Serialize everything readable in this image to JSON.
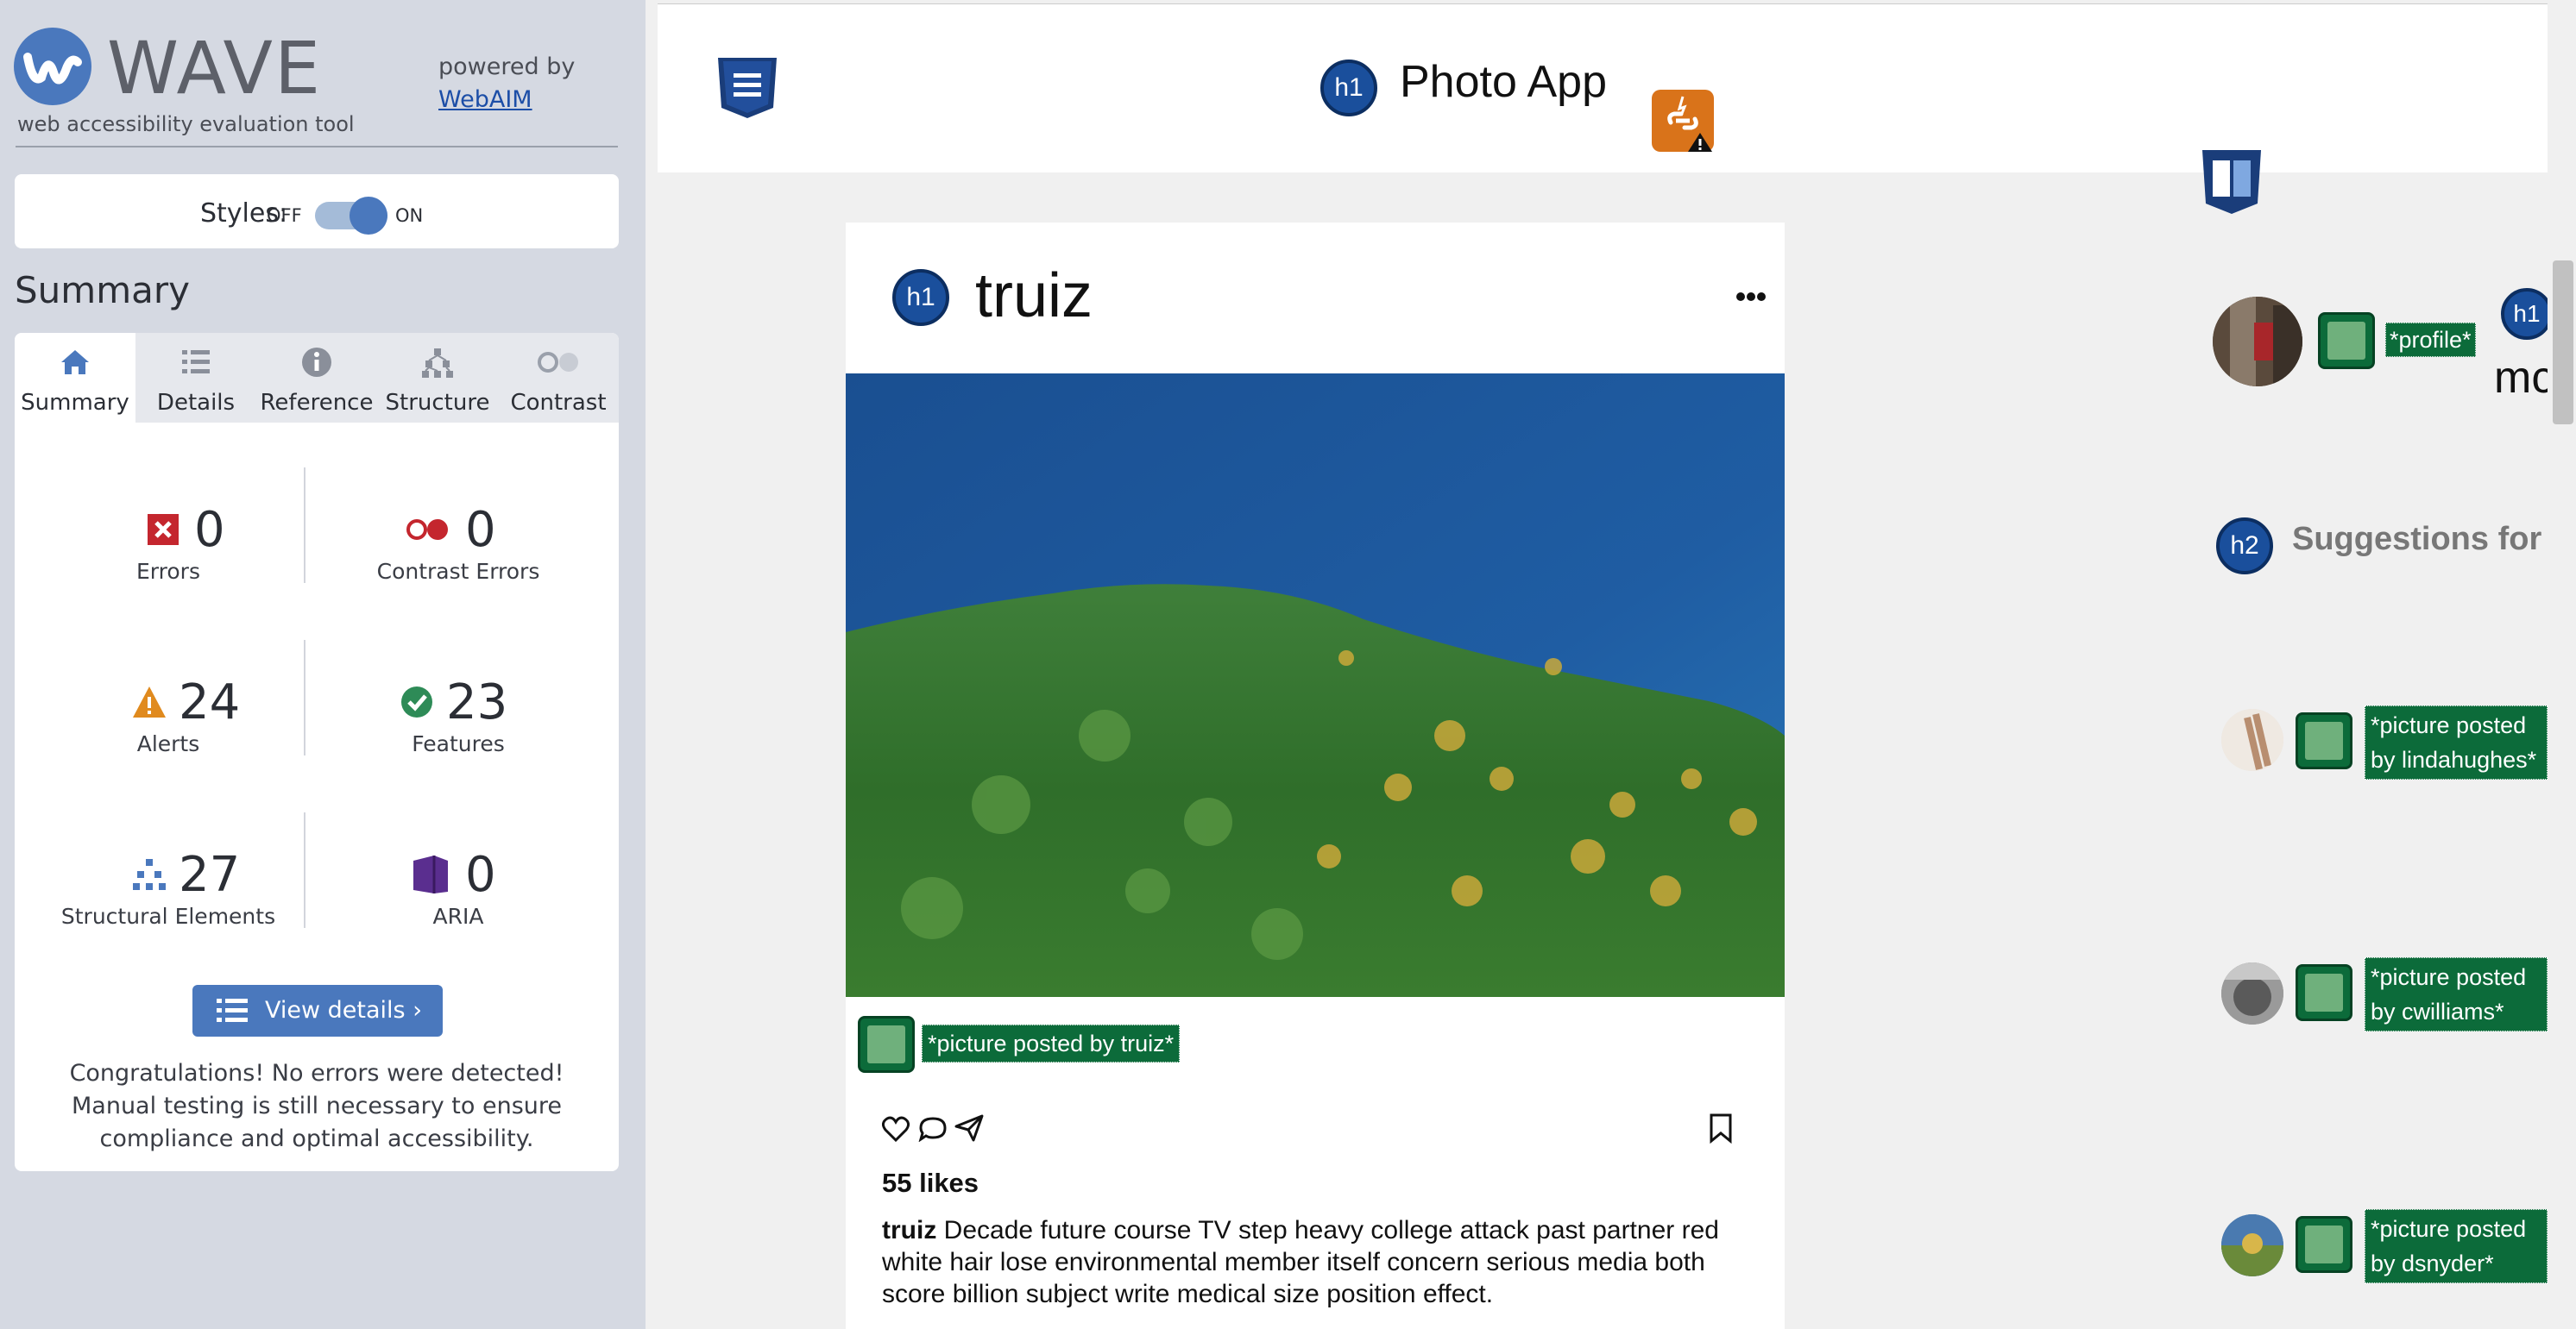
{
  "wave": {
    "logo_text": "WAVE",
    "tagline": "web accessibility evaluation tool",
    "powered_by": "powered by",
    "webaim_link": "WebAIM",
    "styles_label": "Styles:",
    "styles_off": "OFF",
    "styles_on": "ON",
    "styles_enabled": true,
    "summary_heading": "Summary",
    "tabs": [
      {
        "label": "Summary",
        "icon": "home-icon",
        "active": true
      },
      {
        "label": "Details",
        "icon": "list-icon",
        "active": false
      },
      {
        "label": "Reference",
        "icon": "info-icon",
        "active": false
      },
      {
        "label": "Structure",
        "icon": "hierarchy-icon",
        "active": false
      },
      {
        "label": "Contrast",
        "icon": "contrast-icon",
        "active": false
      }
    ],
    "stats": {
      "errors": {
        "value": "0",
        "label": "Errors"
      },
      "contrast_errors": {
        "value": "0",
        "label": "Contrast Errors"
      },
      "alerts": {
        "value": "24",
        "label": "Alerts"
      },
      "features": {
        "value": "23",
        "label": "Features"
      },
      "structural": {
        "value": "27",
        "label": "Structural Elements"
      },
      "aria": {
        "value": "0",
        "label": "ARIA"
      }
    },
    "view_details_label": "View details ›",
    "congrats": "Congratulations! No errors were detected! Manual testing is still necessary to ensure compliance and optimal accessibility.",
    "colors": {
      "accent": "#4a78bd",
      "error": "#c4262e",
      "alert": "#e08a1e",
      "feature": "#2e8b57",
      "aria": "#5a2e8f",
      "sidebar_bg": "#d5d9e2"
    }
  },
  "page": {
    "app_title": "Photo App",
    "h1_badge": "h1",
    "h2_badge": "h2",
    "post": {
      "username": "truiz",
      "photo_alt": "*picture posted by truiz*",
      "likes": "55 likes",
      "caption_user": "truiz",
      "caption_text": " Decade future course TV step heavy college attack past partner red white hair lose environmental member itself concern serious media both score billion subject write medical size position effect."
    },
    "sidebar": {
      "profile_alt": "*profile*",
      "more_text": "mc",
      "suggestions_heading": "Suggestions for",
      "suggestions": [
        {
          "alt": "*picture posted by lindahughes*"
        },
        {
          "alt": "*picture posted by cwilliams*"
        },
        {
          "alt": "*picture posted by dsnyder*"
        }
      ]
    }
  }
}
